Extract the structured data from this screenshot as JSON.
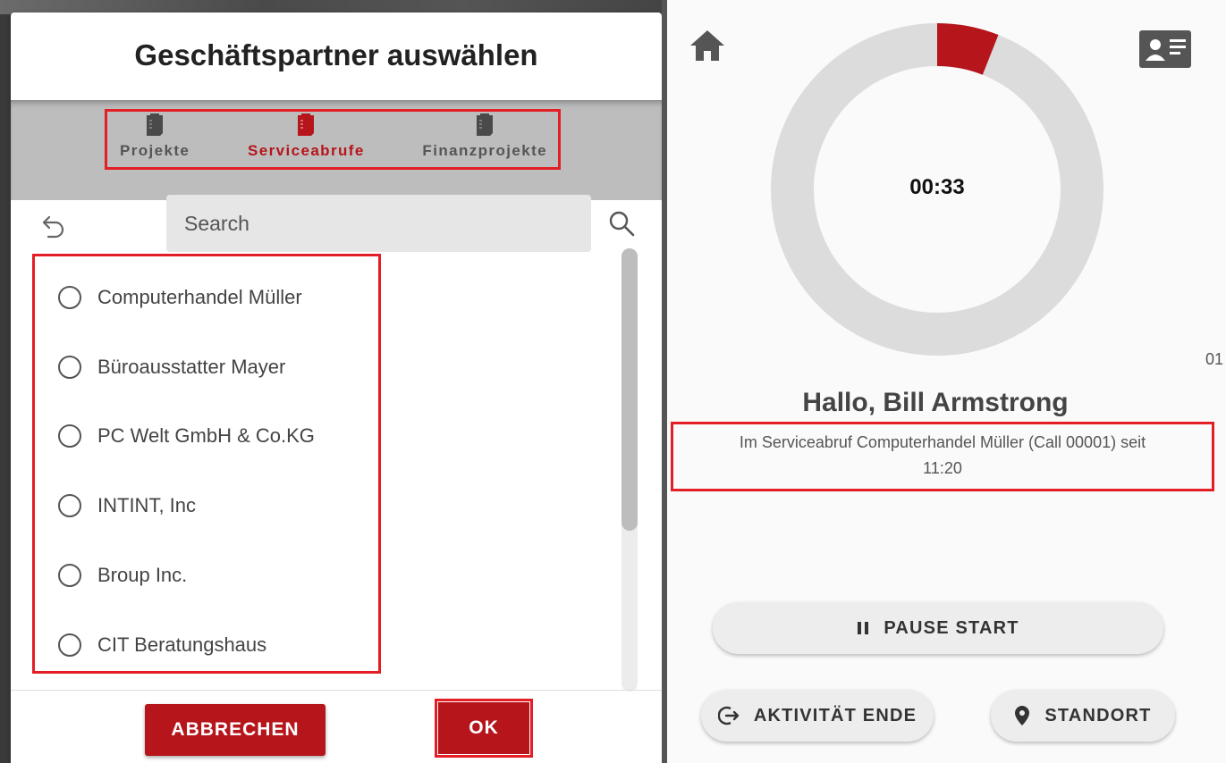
{
  "dialog": {
    "title": "Geschäftspartner auswählen",
    "tabs": [
      {
        "label": "Projekte",
        "active": false
      },
      {
        "label": "Serviceabrufe",
        "active": true
      },
      {
        "label": "Finanzprojekte",
        "active": false
      }
    ],
    "search": {
      "placeholder": "Search",
      "value": ""
    },
    "partners": [
      "Computerhandel Müller",
      "Büroausstatter Mayer",
      "PC Welt GmbH & Co.KG",
      "INTINT, Inc",
      "Broup Inc.",
      "CIT Beratungshaus"
    ],
    "cancel_label": "ABBRECHEN",
    "ok_label": "OK"
  },
  "timer_screen": {
    "elapsed": "00:33",
    "ring_progress": 0.06,
    "side_text": "01",
    "greeting": "Hallo, Bill Armstrong",
    "status_line1": "Im Serviceabruf Computerhandel Müller (Call 00001) seit",
    "status_line2": "11:20",
    "pause_label": "PAUSE START",
    "end_label": "AKTIVITÄT ENDE",
    "location_label": "STANDORT"
  },
  "colors": {
    "accent_red": "#b5151b",
    "highlight_frame": "#e31e24",
    "ring_track": "#dcdcdc"
  },
  "icons": {
    "home": "home-icon",
    "contact_card": "contact-card-icon",
    "undo": "undo-icon",
    "search": "search-icon",
    "tab": "clipboard-icon",
    "pause": "pause-icon",
    "exit": "exit-icon",
    "location": "location-pin-icon"
  }
}
